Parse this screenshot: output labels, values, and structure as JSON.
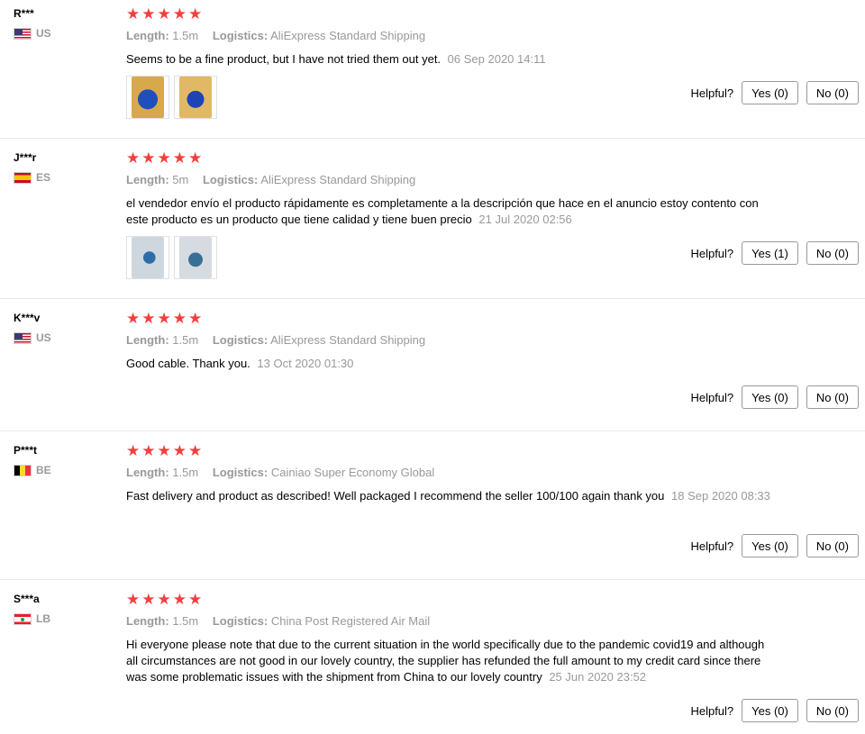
{
  "labels": {
    "length": "Length:",
    "logistics": "Logistics:",
    "helpful": "Helpful?"
  },
  "star_glyph": "★",
  "accent_colors": {
    "star": "#f23f3f",
    "muted": "#999999"
  },
  "reviews": [
    {
      "user": "R***",
      "country": "US",
      "flag_icon": "us-flag-icon",
      "rating": 5,
      "length": "1.5m",
      "logistics": "AliExpress Standard Shipping",
      "text": "Seems to be a fine product, but I have not tried them out yet.",
      "date": "06 Sep 2020 14:11",
      "photos": 2,
      "yes": "Yes (0)",
      "no": "No (0)"
    },
    {
      "user": "J***r",
      "country": "ES",
      "flag_icon": "es-flag-icon",
      "rating": 5,
      "length": "5m",
      "logistics": "AliExpress Standard Shipping",
      "text": "el vendedor envío el producto rápidamente es completamente a la descripción que hace en el anuncio estoy contento con este producto es un producto que tiene calidad y tiene buen precio",
      "date": "21 Jul 2020 02:56",
      "photos": 2,
      "yes": "Yes (1)",
      "no": "No (0)"
    },
    {
      "user": "K***v",
      "country": "US",
      "flag_icon": "us-flag-icon",
      "rating": 5,
      "length": "1.5m",
      "logistics": "AliExpress Standard Shipping",
      "text": "Good cable. Thank you.",
      "date": "13 Oct 2020 01:30",
      "photos": 0,
      "yes": "Yes (0)",
      "no": "No (0)"
    },
    {
      "user": "P***t",
      "country": "BE",
      "flag_icon": "be-flag-icon",
      "rating": 5,
      "length": "1.5m",
      "logistics": "Cainiao Super Economy Global",
      "text": "Fast delivery and product as described! Well packaged I recommend the seller 100/100 again thank you",
      "date": "18 Sep 2020 08:33",
      "photos": 0,
      "yes": "Yes (0)",
      "no": "No (0)"
    },
    {
      "user": "S***a",
      "country": "LB",
      "flag_icon": "lb-flag-icon",
      "rating": 5,
      "length": "1.5m",
      "logistics": "China Post Registered Air Mail",
      "text": "Hi everyone please note that due to the current situation in the world specifically due to the pandemic covid19 and although all circumstances are not good in our lovely country, the supplier has refunded the full amount to my credit card since there was some problematic issues with the shipment from China to our lovely country",
      "date": "25 Jun 2020 23:52",
      "photos": 0,
      "yes": "Yes (0)",
      "no": "No (0)"
    }
  ]
}
